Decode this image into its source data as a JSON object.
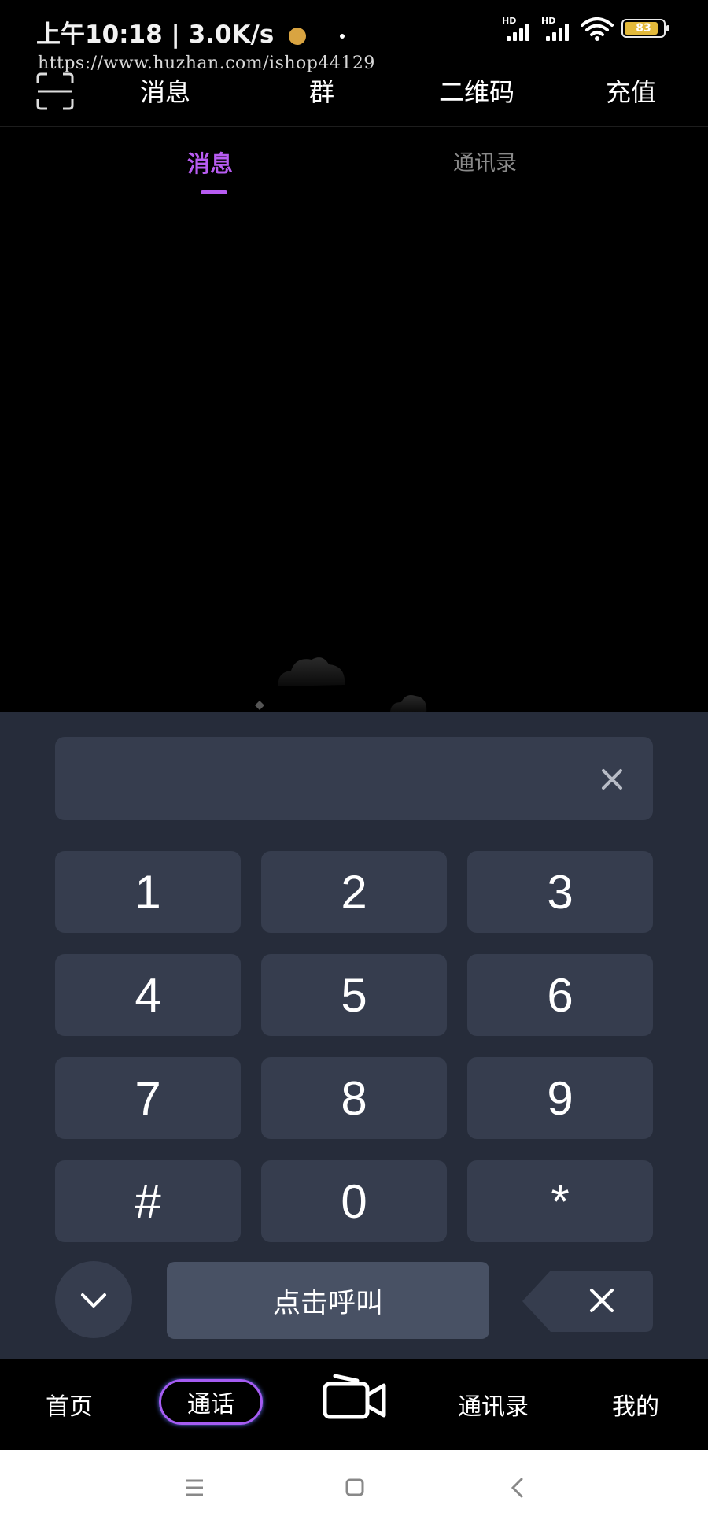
{
  "status_bar": {
    "time": "上午10:18",
    "speed": "3.0K/s",
    "hd_label": "HD",
    "battery": "83"
  },
  "watermark": "https://www.huzhan.com/ishop44129",
  "top_nav": {
    "items": [
      "消息",
      "群",
      "二维码",
      "充值"
    ]
  },
  "tabs": [
    {
      "label": "消息",
      "active": true
    },
    {
      "label": "通讯录",
      "active": false
    }
  ],
  "dial_pad": {
    "input_value": "",
    "keys": [
      "1",
      "2",
      "3",
      "4",
      "5",
      "6",
      "7",
      "8",
      "9",
      "#",
      "0",
      "*"
    ],
    "call_label": "点击呼叫"
  },
  "bottom_nav": {
    "items": [
      "首页",
      "通话",
      "通讯录",
      "我的"
    ],
    "active": "通话"
  },
  "colors": {
    "accent": "#b85cf2",
    "panel": "#262c3a",
    "key": "#363d4e",
    "call_button": "#485164"
  }
}
